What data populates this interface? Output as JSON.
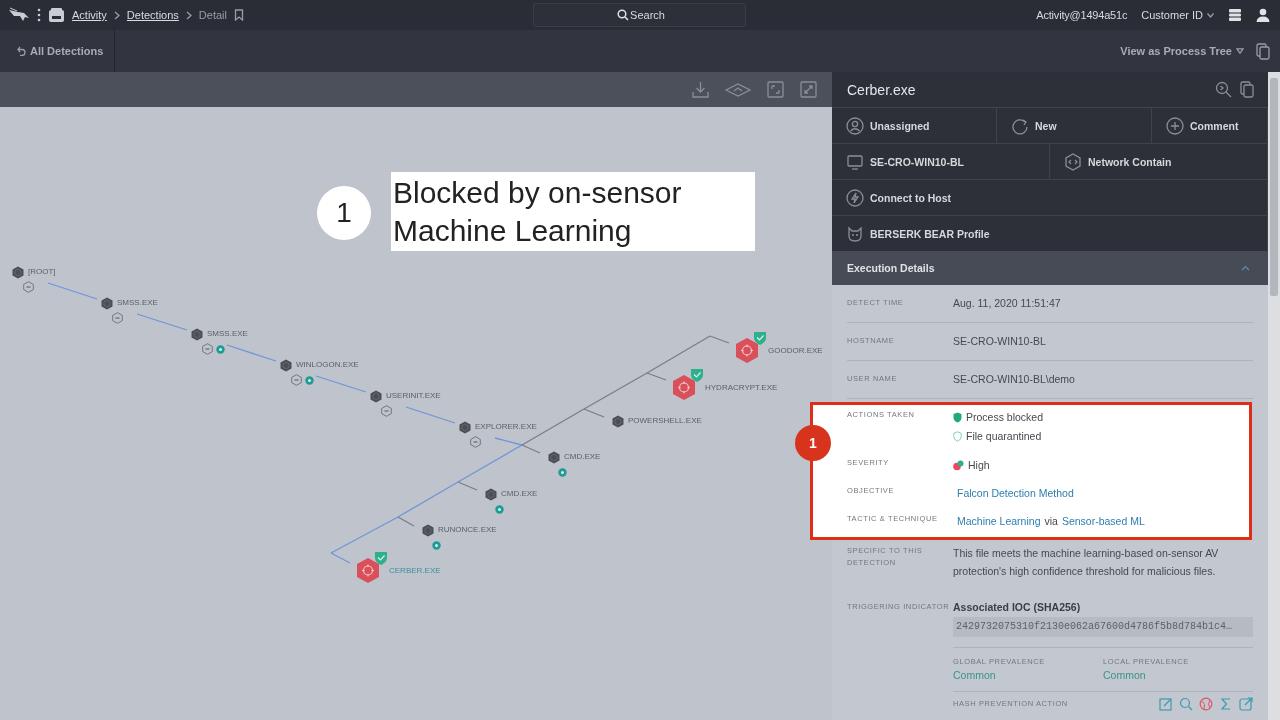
{
  "topbar": {
    "breadcrumbs": [
      {
        "label": "Activity",
        "link": true
      },
      {
        "label": "Detections",
        "link": true
      },
      {
        "label": "Detail",
        "link": false
      }
    ],
    "search": {
      "placeholder": "Search"
    },
    "account": "Activity@1494a51c",
    "customer": "Customer ID"
  },
  "subbar": {
    "back": "All Detections",
    "view": "View as Process Tree"
  },
  "canvas": {
    "annotation": {
      "number": "1",
      "text": "Blocked by on-sensor Machine Learning"
    },
    "tree": [
      {
        "label": "[ROOT]",
        "kind": "process",
        "collapse": true,
        "marker": false,
        "selected": false,
        "children": [
          {
            "label": "SMSS.EXE",
            "kind": "process",
            "collapse": true,
            "marker": false,
            "selected": false,
            "children": [
              {
                "label": "SMSS.EXE",
                "kind": "process",
                "collapse": true,
                "marker": true,
                "selected": false,
                "children": [
                  {
                    "label": "WINLOGON.EXE",
                    "kind": "process",
                    "collapse": true,
                    "marker": true,
                    "selected": false,
                    "children": [
                      {
                        "label": "USERINIT.EXE",
                        "kind": "process",
                        "collapse": true,
                        "marker": false,
                        "selected": false,
                        "children": [
                          {
                            "label": "EXPLORER.EXE",
                            "kind": "process",
                            "collapse": true,
                            "marker": false,
                            "selected": false,
                            "children": [
                              {
                                "label": "GOODOR.EXE",
                                "kind": "detection",
                                "collapse": false,
                                "marker": false,
                                "selected": false
                              },
                              {
                                "label": "HYDRACRYPT.EXE",
                                "kind": "detection",
                                "collapse": false,
                                "marker": false,
                                "selected": false
                              },
                              {
                                "label": "POWERSHELL.EXE",
                                "kind": "process",
                                "collapse": false,
                                "marker": false,
                                "selected": false
                              },
                              {
                                "label": "CMD.EXE",
                                "kind": "process",
                                "collapse": false,
                                "marker": true,
                                "selected": false
                              },
                              {
                                "label": "CMD.EXE",
                                "kind": "process",
                                "collapse": false,
                                "marker": true,
                                "selected": false
                              },
                              {
                                "label": "RUNONCE.EXE",
                                "kind": "process",
                                "collapse": false,
                                "marker": true,
                                "selected": false
                              },
                              {
                                "label": "CERBER.EXE",
                                "kind": "detection",
                                "collapse": false,
                                "marker": false,
                                "selected": true
                              }
                            ]
                          }
                        ]
                      }
                    ]
                  }
                ]
              }
            ]
          }
        ]
      }
    ]
  },
  "panel": {
    "title": "Cerber.exe",
    "actions": [
      {
        "cells": [
          {
            "label": "Unassigned"
          },
          {
            "label": "New"
          },
          {
            "label": "Comment"
          }
        ]
      },
      {
        "cells": [
          {
            "label": "SE-CRO-WIN10-BL"
          },
          {
            "label": "Network Contain"
          }
        ]
      },
      {
        "cells": [
          {
            "label": "Connect to Host"
          }
        ]
      },
      {
        "cells": [
          {
            "label": "BERSERK BEAR Profile"
          }
        ]
      }
    ],
    "section": {
      "title": "Execution Details",
      "expanded": true
    },
    "callout": {
      "number": "1"
    },
    "details": [
      {
        "label": "DETECT TIME",
        "kind": "text",
        "value": "Aug. 11, 2020 11:51:47",
        "highlighted": false
      },
      {
        "label": "HOSTNAME",
        "kind": "text",
        "value": "SE-CRO-WIN10-BL",
        "highlighted": false
      },
      {
        "label": "USER NAME",
        "kind": "text",
        "value": "SE-CRO-WIN10-BL\\demo",
        "highlighted": false
      },
      {
        "label": "ACTIONS TAKEN",
        "kind": "actions",
        "items": [
          {
            "text": "Process blocked",
            "active": true
          },
          {
            "text": "File quarantined",
            "active": false
          }
        ],
        "highlighted": true
      },
      {
        "label": "SEVERITY",
        "kind": "severity",
        "value": "High",
        "highlighted": true
      },
      {
        "label": "OBJECTIVE",
        "kind": "links",
        "parts": [
          {
            "text": "Falcon Detection Method",
            "link": true
          }
        ],
        "highlighted": true
      },
      {
        "label": "TACTIC & TECHNIQUE",
        "kind": "links",
        "parts": [
          {
            "text": "Machine Learning",
            "link": true
          },
          {
            "text": "via",
            "link": false
          },
          {
            "text": "Sensor-based ML",
            "link": true
          }
        ],
        "highlighted": true
      },
      {
        "label": "SPECIFIC TO THIS DETECTION",
        "kind": "paragraph",
        "value": "This file meets the machine learning-based on-sensor AV protection's high confidence threshold for malicious files.",
        "highlighted": false
      },
      {
        "label": "TRIGGERING INDICATOR",
        "kind": "indicator",
        "title": "Associated IOC (SHA256)",
        "hash": "2429732075310f2130e062a67600d4786f5b8d784b1c4…",
        "prevalence": [
          {
            "label": "GLOBAL PREVALENCE",
            "value": "Common"
          },
          {
            "label": "LOCAL PREVALENCE",
            "value": "Common"
          }
        ],
        "footer": "HASH PREVENTION ACTION",
        "highlighted": false
      }
    ]
  }
}
